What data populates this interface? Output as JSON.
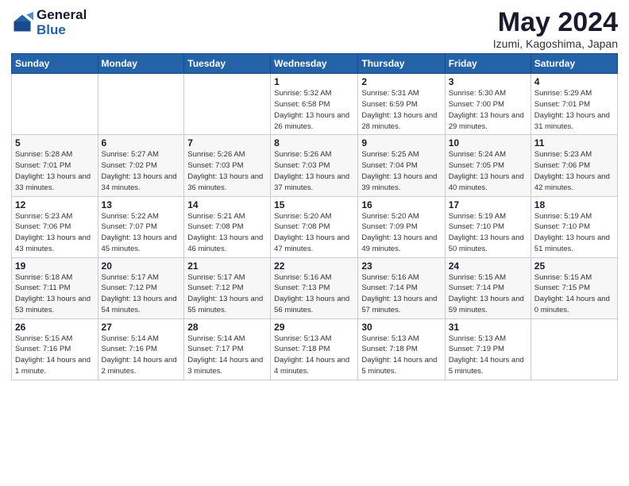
{
  "header": {
    "logo_line1": "General",
    "logo_line2": "Blue",
    "title": "May 2024",
    "subtitle": "Izumi, Kagoshima, Japan"
  },
  "weekdays": [
    "Sunday",
    "Monday",
    "Tuesday",
    "Wednesday",
    "Thursday",
    "Friday",
    "Saturday"
  ],
  "weeks": [
    [
      {
        "day": "",
        "info": ""
      },
      {
        "day": "",
        "info": ""
      },
      {
        "day": "",
        "info": ""
      },
      {
        "day": "1",
        "info": "Sunrise: 5:32 AM\nSunset: 6:58 PM\nDaylight: 13 hours\nand 26 minutes."
      },
      {
        "day": "2",
        "info": "Sunrise: 5:31 AM\nSunset: 6:59 PM\nDaylight: 13 hours\nand 28 minutes."
      },
      {
        "day": "3",
        "info": "Sunrise: 5:30 AM\nSunset: 7:00 PM\nDaylight: 13 hours\nand 29 minutes."
      },
      {
        "day": "4",
        "info": "Sunrise: 5:29 AM\nSunset: 7:01 PM\nDaylight: 13 hours\nand 31 minutes."
      }
    ],
    [
      {
        "day": "5",
        "info": "Sunrise: 5:28 AM\nSunset: 7:01 PM\nDaylight: 13 hours\nand 33 minutes."
      },
      {
        "day": "6",
        "info": "Sunrise: 5:27 AM\nSunset: 7:02 PM\nDaylight: 13 hours\nand 34 minutes."
      },
      {
        "day": "7",
        "info": "Sunrise: 5:26 AM\nSunset: 7:03 PM\nDaylight: 13 hours\nand 36 minutes."
      },
      {
        "day": "8",
        "info": "Sunrise: 5:26 AM\nSunset: 7:03 PM\nDaylight: 13 hours\nand 37 minutes."
      },
      {
        "day": "9",
        "info": "Sunrise: 5:25 AM\nSunset: 7:04 PM\nDaylight: 13 hours\nand 39 minutes."
      },
      {
        "day": "10",
        "info": "Sunrise: 5:24 AM\nSunset: 7:05 PM\nDaylight: 13 hours\nand 40 minutes."
      },
      {
        "day": "11",
        "info": "Sunrise: 5:23 AM\nSunset: 7:06 PM\nDaylight: 13 hours\nand 42 minutes."
      }
    ],
    [
      {
        "day": "12",
        "info": "Sunrise: 5:23 AM\nSunset: 7:06 PM\nDaylight: 13 hours\nand 43 minutes."
      },
      {
        "day": "13",
        "info": "Sunrise: 5:22 AM\nSunset: 7:07 PM\nDaylight: 13 hours\nand 45 minutes."
      },
      {
        "day": "14",
        "info": "Sunrise: 5:21 AM\nSunset: 7:08 PM\nDaylight: 13 hours\nand 46 minutes."
      },
      {
        "day": "15",
        "info": "Sunrise: 5:20 AM\nSunset: 7:08 PM\nDaylight: 13 hours\nand 47 minutes."
      },
      {
        "day": "16",
        "info": "Sunrise: 5:20 AM\nSunset: 7:09 PM\nDaylight: 13 hours\nand 49 minutes."
      },
      {
        "day": "17",
        "info": "Sunrise: 5:19 AM\nSunset: 7:10 PM\nDaylight: 13 hours\nand 50 minutes."
      },
      {
        "day": "18",
        "info": "Sunrise: 5:19 AM\nSunset: 7:10 PM\nDaylight: 13 hours\nand 51 minutes."
      }
    ],
    [
      {
        "day": "19",
        "info": "Sunrise: 5:18 AM\nSunset: 7:11 PM\nDaylight: 13 hours\nand 53 minutes."
      },
      {
        "day": "20",
        "info": "Sunrise: 5:17 AM\nSunset: 7:12 PM\nDaylight: 13 hours\nand 54 minutes."
      },
      {
        "day": "21",
        "info": "Sunrise: 5:17 AM\nSunset: 7:12 PM\nDaylight: 13 hours\nand 55 minutes."
      },
      {
        "day": "22",
        "info": "Sunrise: 5:16 AM\nSunset: 7:13 PM\nDaylight: 13 hours\nand 56 minutes."
      },
      {
        "day": "23",
        "info": "Sunrise: 5:16 AM\nSunset: 7:14 PM\nDaylight: 13 hours\nand 57 minutes."
      },
      {
        "day": "24",
        "info": "Sunrise: 5:15 AM\nSunset: 7:14 PM\nDaylight: 13 hours\nand 59 minutes."
      },
      {
        "day": "25",
        "info": "Sunrise: 5:15 AM\nSunset: 7:15 PM\nDaylight: 14 hours\nand 0 minutes."
      }
    ],
    [
      {
        "day": "26",
        "info": "Sunrise: 5:15 AM\nSunset: 7:16 PM\nDaylight: 14 hours\nand 1 minute."
      },
      {
        "day": "27",
        "info": "Sunrise: 5:14 AM\nSunset: 7:16 PM\nDaylight: 14 hours\nand 2 minutes."
      },
      {
        "day": "28",
        "info": "Sunrise: 5:14 AM\nSunset: 7:17 PM\nDaylight: 14 hours\nand 3 minutes."
      },
      {
        "day": "29",
        "info": "Sunrise: 5:13 AM\nSunset: 7:18 PM\nDaylight: 14 hours\nand 4 minutes."
      },
      {
        "day": "30",
        "info": "Sunrise: 5:13 AM\nSunset: 7:18 PM\nDaylight: 14 hours\nand 5 minutes."
      },
      {
        "day": "31",
        "info": "Sunrise: 5:13 AM\nSunset: 7:19 PM\nDaylight: 14 hours\nand 5 minutes."
      },
      {
        "day": "",
        "info": ""
      }
    ]
  ]
}
